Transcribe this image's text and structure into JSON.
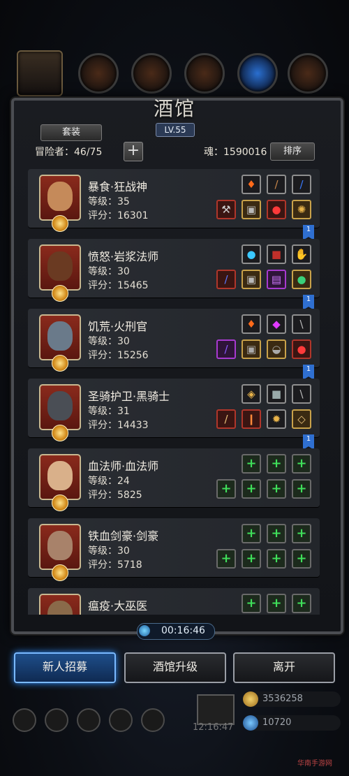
{
  "header": {
    "title": "酒馆",
    "level": "LV.55",
    "set_label": "套装",
    "adventurer_label": "冒险者：46/75",
    "plus_symbol": "+",
    "soul_label": "魂：1590016",
    "sort_label": "排序"
  },
  "heroes": [
    {
      "name": "暴食·狂战神",
      "level": "等级：35",
      "score": "评分：16301",
      "flag": "1"
    },
    {
      "name": "愤怒·岩浆法师",
      "level": "等级：30",
      "score": "评分：15465",
      "flag": "1"
    },
    {
      "name": "饥荒·火刑官",
      "level": "等级：30",
      "score": "评分：15256",
      "flag": "1"
    },
    {
      "name": "圣骑护卫·黑骑士",
      "level": "等级：31",
      "score": "评分：14433",
      "flag": "1"
    },
    {
      "name": "血法师·血法师",
      "level": "等级：24",
      "score": "评分：5825"
    },
    {
      "name": "铁血剑豪·剑豪",
      "level": "等级：30",
      "score": "评分：5718"
    },
    {
      "name": "瘟疫·大巫医"
    }
  ],
  "timer": {
    "value": "00:16:46"
  },
  "actions": {
    "recruit": "新人招募",
    "upgrade": "酒馆升级",
    "leave": "离开"
  },
  "footer": {
    "clock": "12:16:47",
    "gold": "3536258",
    "gems": "10720",
    "watermark": "华南手游网"
  },
  "colors": {
    "accent_blue": "#2f8fff",
    "plus_green": "#3fe05a",
    "panel_bg": "#1a1c21"
  }
}
